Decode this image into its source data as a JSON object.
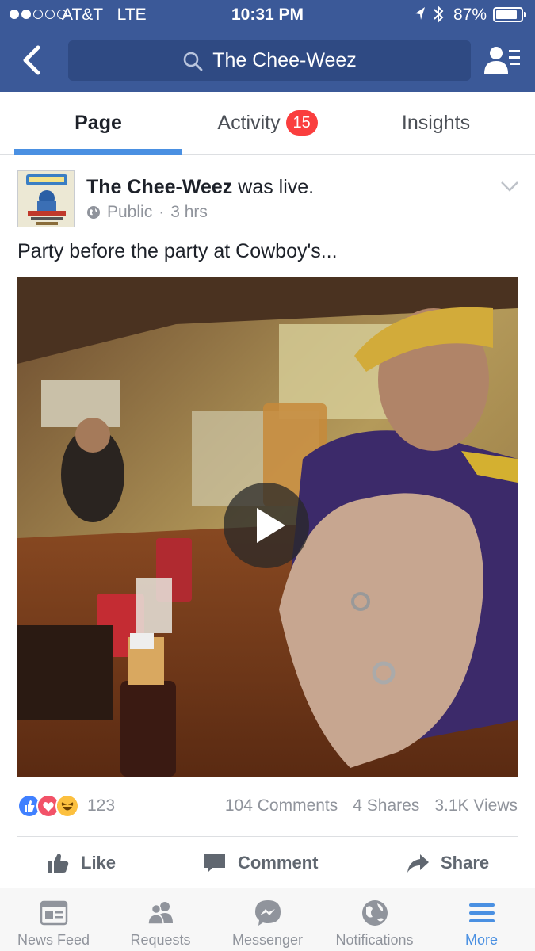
{
  "status_bar": {
    "carrier": "AT&T",
    "network": "LTE",
    "time": "10:31 PM",
    "battery": "87%",
    "battery_level": 0.87
  },
  "header": {
    "search_text": "The Chee-Weez",
    "back_icon": "chevron-left-icon",
    "right_icon": "profile-menu-icon"
  },
  "tabs": {
    "page": "Page",
    "activity": "Activity",
    "activity_badge": "15",
    "insights": "Insights"
  },
  "post": {
    "author": "The Chee-Weez",
    "action": "was live.",
    "privacy": "Public",
    "separator": "·",
    "time": "3 hrs",
    "text": "Party before the party at Cowboy's...",
    "reactions_count": "123",
    "comments": "104 Comments",
    "shares": "4 Shares",
    "views": "3.1K Views"
  },
  "actions": {
    "like": "Like",
    "comment": "Comment",
    "share": "Share"
  },
  "bottom_nav": [
    {
      "label": "News Feed",
      "icon": "news-feed-icon"
    },
    {
      "label": "Requests",
      "icon": "friends-icon"
    },
    {
      "label": "Messenger",
      "icon": "messenger-icon"
    },
    {
      "label": "Notifications",
      "icon": "globe-icon"
    },
    {
      "label": "More",
      "icon": "hamburger-menu-icon"
    }
  ],
  "colors": {
    "brand": "#3b5998",
    "active_tab": "#4a90e2",
    "badge": "#fa3e3e",
    "like": "#4080ff",
    "love": "#f25268",
    "haha": "#fcc03f"
  }
}
